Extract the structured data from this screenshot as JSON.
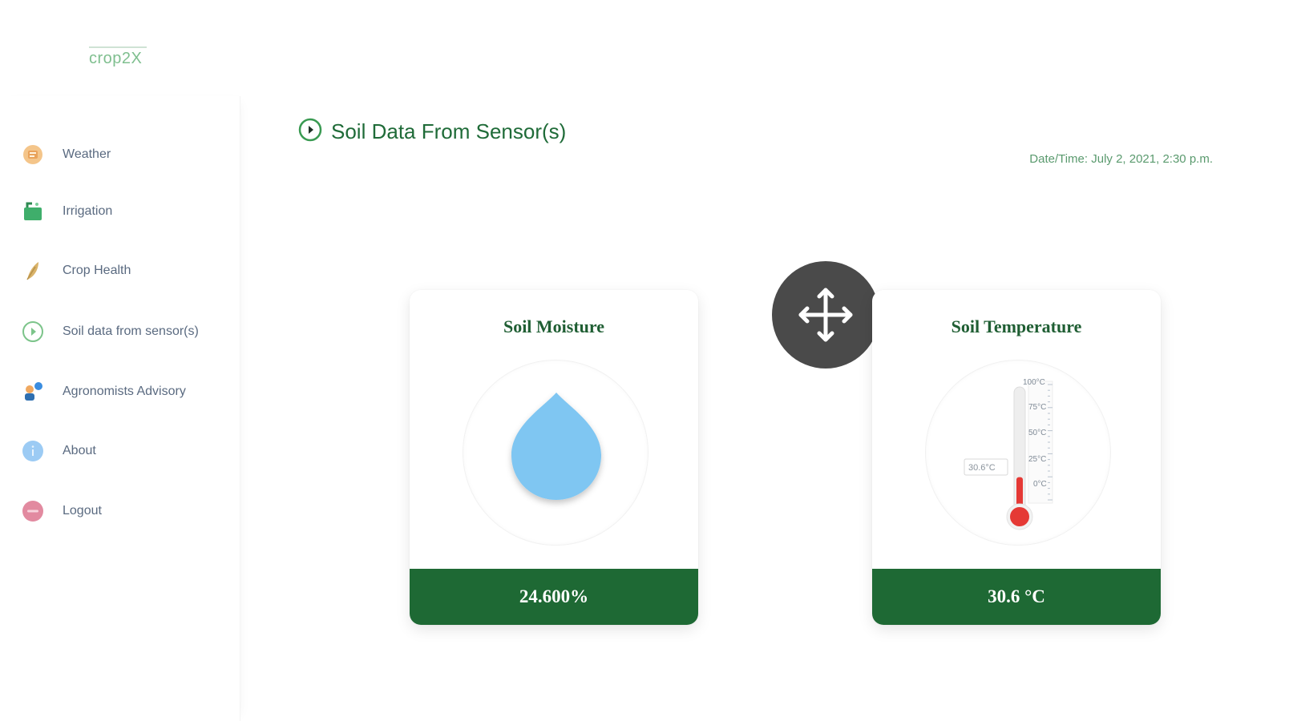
{
  "app": {
    "logo": "crop2X"
  },
  "sidebar": {
    "items": [
      {
        "label": "Weather",
        "icon": "weather-icon"
      },
      {
        "label": "Irrigation",
        "icon": "irrigation-icon"
      },
      {
        "label": "Crop Health",
        "icon": "crop-health-icon"
      },
      {
        "label": "Soil data from sensor(s)",
        "icon": "sensor-icon"
      },
      {
        "label": "Agronomists Advisory",
        "icon": "advisory-icon"
      },
      {
        "label": "About",
        "icon": "info-icon"
      },
      {
        "label": "Logout",
        "icon": "logout-icon"
      }
    ]
  },
  "main": {
    "title": "Soil Data From Sensor(s)",
    "datetime": "Date/Time: July 2, 2021, 2:30 p.m.",
    "cards": {
      "moisture": {
        "title": "Soil Moisture",
        "value": "24.600%"
      },
      "temperature": {
        "title": "Soil Temperature",
        "value": "30.6 °C",
        "reading_label": "30.6°C",
        "scale": [
          "100°C",
          "75°C",
          "50°C",
          "25°C",
          "0°C"
        ],
        "level": 0.306
      }
    }
  },
  "colors": {
    "brand_green": "#1e6934",
    "title_green": "#1f6b38",
    "water_blue": "#7fc6f2",
    "mercury_red": "#e53935",
    "handle_gray": "#4a4a4a"
  }
}
